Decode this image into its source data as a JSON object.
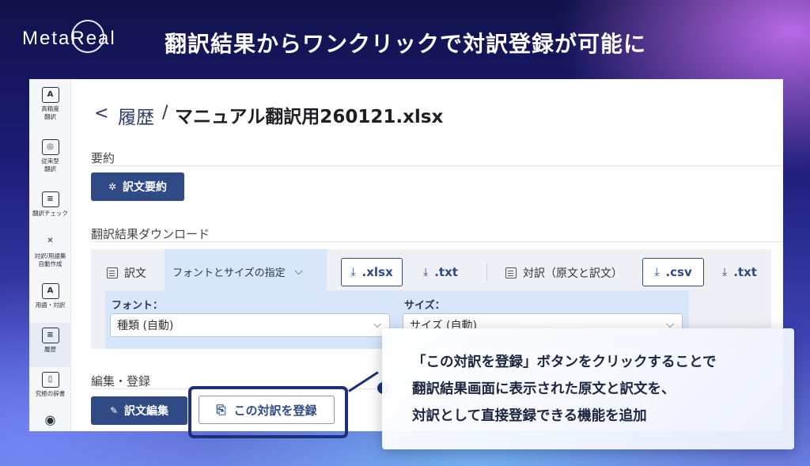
{
  "brand": {
    "logo_text": "MetaReal"
  },
  "headline": "翻訳結果からワンクリックで対訳登録が可能に",
  "sidebar": {
    "items": [
      {
        "glyph": "A",
        "label": "高精度\n翻訳"
      },
      {
        "glyph": "◎",
        "label": "従来型\n翻訳"
      },
      {
        "glyph": "≡",
        "label": "翻訳チェック"
      },
      {
        "glyph": "✕",
        "label": "対訳/用語集\n自動作成"
      },
      {
        "glyph": "A",
        "label": "用語・対訳"
      },
      {
        "glyph": "≡",
        "label": "履歴"
      },
      {
        "glyph": "▯",
        "label": "究極の辞書"
      },
      {
        "glyph": "◉",
        "label": ""
      }
    ]
  },
  "breadcrumb": {
    "back_glyph": "<",
    "parent": "履歴",
    "separator": "/",
    "title": "マニュアル翻訳用260121.xlsx"
  },
  "summary": {
    "section_label": "要約",
    "button_label": "訳文要約",
    "button_icon": "✲"
  },
  "download": {
    "section_label": "翻訳結果ダウンロード",
    "translation_label": "訳文",
    "font_tab_label": "フォントとサイズの指定",
    "font_tab_chevron": "⌵",
    "xlsx_label": ".xlsx",
    "txt_label": ".txt",
    "bilingual_label": "対訳（原文と訳文）",
    "csv_label": ".csv",
    "txt2_label": ".txt",
    "download_glyph": "⤓",
    "font_field": {
      "label": "フォント：",
      "value": "種類 (自動)"
    },
    "size_field": {
      "label": "サイズ：",
      "value": "サイズ (自動)"
    },
    "select_chevron": "⌵"
  },
  "edit": {
    "section_label": "編集・登録",
    "edit_button_label": "訳文編集",
    "edit_button_icon": "✎",
    "register_button_label": "この対訳を登録",
    "register_button_icon": "⎘"
  },
  "callout": {
    "lines": [
      "「この対訳を登録」ボタンをクリックすることで",
      "翻訳結果画面に表示された原文と訳文を、",
      "対訳として直接登録できる機能を追加"
    ]
  }
}
